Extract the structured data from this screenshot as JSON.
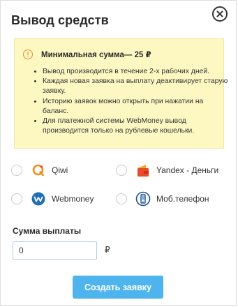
{
  "dialog": {
    "title": "Вывод средств",
    "close_icon": "close-icon"
  },
  "notice": {
    "icon": "info-icon",
    "icon_glyph": "!",
    "title": "Минимальная сумма— 25 ₽",
    "items": [
      "Вывод производится в течение 2-х рабочих дней.",
      "Каждая новая заявка на выплату деактивирует старую заявку.",
      "Историю заявок можно открыть при нажатии на баланс.",
      "Для платежной системы WebMoney вывод производится только на рублевые кошельки."
    ]
  },
  "methods": [
    {
      "label": "Qiwi",
      "icon": "qiwi-icon",
      "selected": false
    },
    {
      "label": "Yandex - Деньги",
      "icon": "yandex-money-icon",
      "selected": false
    },
    {
      "label": "Webmoney",
      "icon": "webmoney-icon",
      "selected": false
    },
    {
      "label": "Моб.телефон",
      "icon": "mobile-phone-icon",
      "selected": false
    }
  ],
  "amount": {
    "label": "Сумма выплаты",
    "value": "0",
    "currency": "₽"
  },
  "submit_label": "Создать заявку",
  "colors": {
    "accent": "#4db4ee",
    "notice_bg": "#fdf8c2",
    "warning": "#e58a2f"
  }
}
